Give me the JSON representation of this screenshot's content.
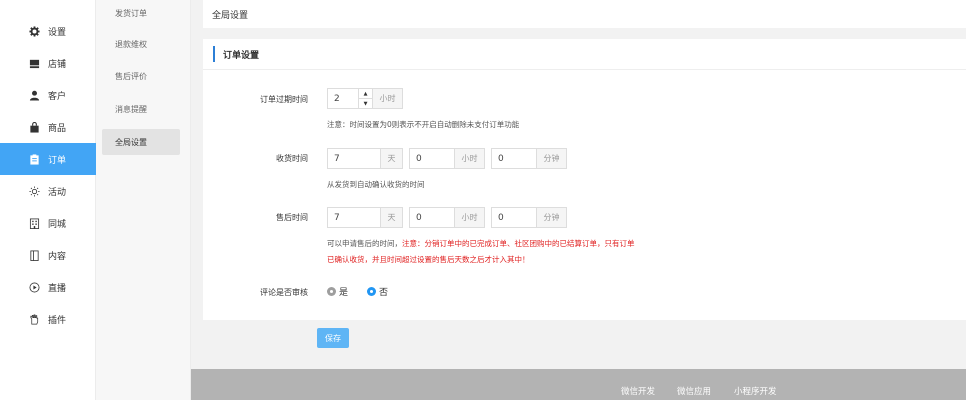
{
  "sidebar": {
    "items": [
      {
        "label": "设置",
        "icon": "gear-icon"
      },
      {
        "label": "店铺",
        "icon": "store-icon"
      },
      {
        "label": "客户",
        "icon": "user-icon"
      },
      {
        "label": "商品",
        "icon": "bag-icon"
      },
      {
        "label": "订单",
        "icon": "clipboard-icon"
      },
      {
        "label": "活动",
        "icon": "sun-icon"
      },
      {
        "label": "同城",
        "icon": "building-icon"
      },
      {
        "label": "内容",
        "icon": "page-icon"
      },
      {
        "label": "直播",
        "icon": "play-icon"
      },
      {
        "label": "插件",
        "icon": "hand-icon"
      }
    ],
    "active_index": 4,
    "active_color": "#42a5f5"
  },
  "submenu": {
    "items": [
      "发货订单",
      "退款维权",
      "售后评价",
      "消息提醒",
      "全局设置"
    ],
    "active_index": 4
  },
  "page": {
    "title": "全局设置",
    "section_title": "订单设置"
  },
  "form": {
    "expire": {
      "label": "订单过期时间",
      "value": "2",
      "unit": "小时",
      "note": "注意：时间设置为0则表示不开启自动删除未支付订单功能"
    },
    "receive": {
      "label": "收货时间",
      "days": "7",
      "days_unit": "天",
      "hours": "0",
      "hours_unit": "小时",
      "minutes": "0",
      "minutes_unit": "分钟",
      "note": "从发货到自动确认收货的时间"
    },
    "aftersale": {
      "label": "售后时间",
      "days": "7",
      "days_unit": "天",
      "hours": "0",
      "hours_unit": "小时",
      "minutes": "0",
      "minutes_unit": "分钟",
      "note_prefix": "可以申请售后的时间，",
      "note_red_1": "注意：分销订单中的已完成订单、社区团购中的已结算订单，只有订单",
      "note_red_2": "已确认收货，并且时间超过设置的售后天数之后才计入其中！"
    },
    "review": {
      "label": "评论是否审核",
      "option_yes": "是",
      "option_no": "否",
      "selected": "否"
    }
  },
  "actions": {
    "save_label": "保存"
  },
  "footer": {
    "links": [
      "微信开发",
      "微信应用",
      "小程序开发"
    ]
  }
}
